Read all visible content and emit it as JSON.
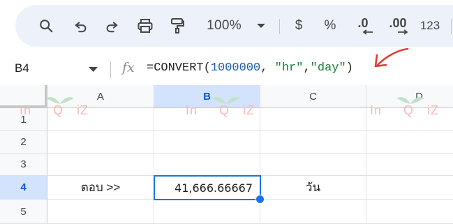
{
  "toolbar": {
    "items": [
      {
        "name": "search-icon"
      },
      {
        "name": "undo-icon"
      },
      {
        "name": "redo-icon"
      },
      {
        "name": "print-icon"
      },
      {
        "name": "paint-format-icon"
      }
    ],
    "zoom_value": "100%",
    "currency_label": "$",
    "percent_label": "%",
    "decrease_decimal_label": ".0",
    "increase_decimal_label": ".00",
    "more_formats_label": "123"
  },
  "formula_bar": {
    "name_box": "B4",
    "fx_label": "fx",
    "formula_prefix": "=CONVERT(",
    "formula_number": "1000000",
    "formula_sep1": ", ",
    "formula_str1": "\"hr\"",
    "formula_sep2": ",",
    "formula_str2": "\"day\"",
    "formula_suffix": ")"
  },
  "sheet": {
    "columns": [
      "A",
      "B",
      "C",
      "D"
    ],
    "rows": [
      "1",
      "2",
      "3",
      "4",
      "5"
    ],
    "cells": {
      "A4": "ตอบ >>",
      "B4": "41,666.66667",
      "C4": "วัน"
    },
    "selected_cell": "B4"
  },
  "watermark": {
    "text_left": "In",
    "text_mid": "Q",
    "text_right": "iZ"
  },
  "colors": {
    "accent": "#1a73e8",
    "annotation": "#e53935",
    "toolbar_bg": "#edf2fa"
  }
}
